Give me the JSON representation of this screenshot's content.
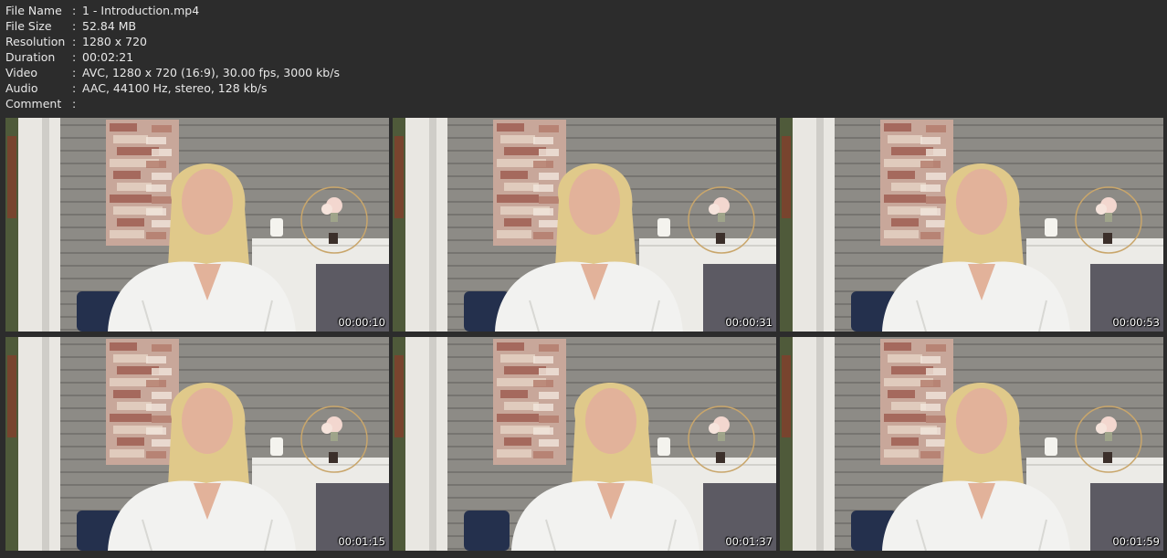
{
  "metadata": [
    {
      "key": "File Name",
      "value": "1 - Introduction.mp4"
    },
    {
      "key": "File Size",
      "value": "52.84 MB"
    },
    {
      "key": "Resolution",
      "value": "1280 x 720"
    },
    {
      "key": "Duration",
      "value": "00:02:21"
    },
    {
      "key": "Video",
      "value": "AVC, 1280 x 720 (16:9), 30.00 fps, 3000 kb/s"
    },
    {
      "key": "Audio",
      "value": "AAC, 44100 Hz, stereo, 128 kb/s"
    },
    {
      "key": "Comment",
      "value": ""
    }
  ],
  "separator": ":",
  "thumbnails": [
    {
      "timestamp": "00:00:10"
    },
    {
      "timestamp": "00:00:31"
    },
    {
      "timestamp": "00:00:53"
    },
    {
      "timestamp": "00:01:15"
    },
    {
      "timestamp": "00:01:37"
    },
    {
      "timestamp": "00:01:59"
    }
  ],
  "colors": {
    "background": "#2c2c2c",
    "text": "#e8e8e8",
    "jacket": "#f2f2f0",
    "hair": "#e0c98a",
    "wall": "#8d8b86"
  }
}
